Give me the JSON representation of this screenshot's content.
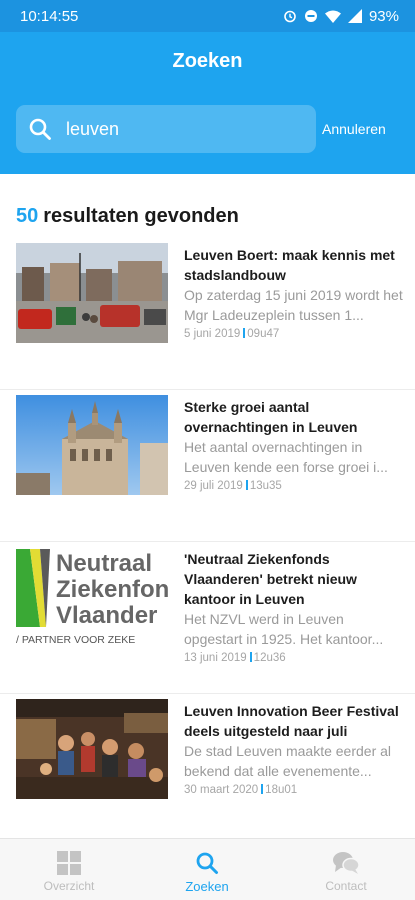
{
  "status_bar": {
    "time": "10:14:55",
    "battery": "93%"
  },
  "header": {
    "title": "Zoeken"
  },
  "search": {
    "value": "leuven",
    "cancel_label": "Annuleren"
  },
  "results": {
    "count": "50",
    "label": "resultaten gevonden",
    "items": [
      {
        "title": "Leuven Boert: maak kennis met stadslandbouw",
        "description": "Op zaterdag 15 juni 2019 wordt het Mgr Ladeuzeplein tussen 1...",
        "date": "5 juni 2019",
        "time": "09u47"
      },
      {
        "title": "Sterke groei aantal overnachtingen in Leuven",
        "description": "Het aantal overnachtingen in Leuven kende een forse groei i...",
        "date": "29 juli 2019",
        "time": "13u35"
      },
      {
        "title": "'Neutraal Ziekenfonds Vlaanderen' betrekt nieuw kantoor in Leuven",
        "description": "Het NZVL werd in Leuven opgestart in 1925. Het kantoor...",
        "date": "13 juni 2019",
        "time": "12u36",
        "logo": {
          "line1": "Neutraal",
          "line2": "Ziekenfon",
          "line3": "Vlaander",
          "tagline": "/ PARTNER VOOR ZEKE"
        }
      },
      {
        "title": "Leuven Innovation Beer Festival deels uitgesteld naar juli",
        "description": "De stad Leuven maakte eerder al bekend dat alle evenemente...",
        "date": "30 maart 2020",
        "time": "18u01"
      }
    ]
  },
  "tabs": [
    {
      "label": "Overzicht",
      "icon": "grid-icon",
      "active": false
    },
    {
      "label": "Zoeken",
      "icon": "search-icon",
      "active": true
    },
    {
      "label": "Contact",
      "icon": "chat-icon",
      "active": false
    }
  ],
  "colors": {
    "primary": "#1ea4ef",
    "status_bar": "#1c93e0"
  }
}
